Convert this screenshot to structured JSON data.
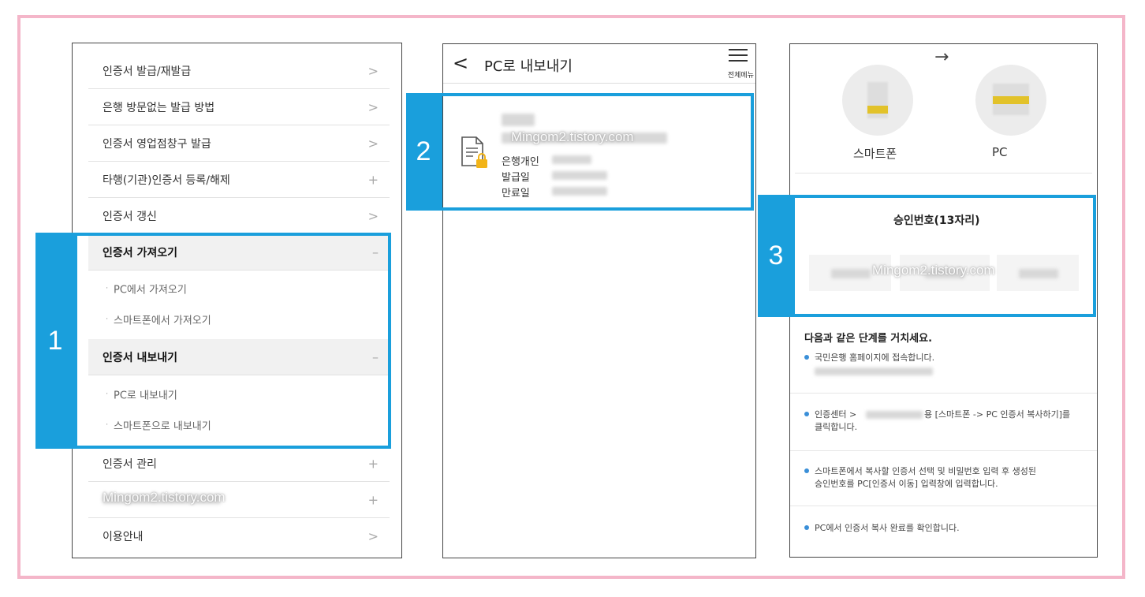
{
  "panel1": {
    "menu": [
      {
        "label": "인증서 발급/재발급",
        "sign": ">"
      },
      {
        "label": "은행 방문없는 발급 방법",
        "sign": ">"
      },
      {
        "label": "인증서 영업점창구 발급",
        "sign": ">"
      },
      {
        "label": "타행(기관)인증서 등록/해제",
        "sign": "+"
      },
      {
        "label": "인증서 갱신",
        "sign": ">"
      },
      {
        "label": "인증서 가져오기",
        "sign": "–"
      },
      {
        "label": "인증서 내보내기",
        "sign": "–"
      },
      {
        "label": "인증서 관리",
        "sign": "+"
      },
      {
        "label": "",
        "sign": "+"
      },
      {
        "label": "이용안내",
        "sign": ">"
      }
    ],
    "import_sub": [
      "PC에서 가져오기",
      "스마트폰에서 가져오기"
    ],
    "export_sub": [
      "PC로 내보내기",
      "스마트폰으로 내보내기"
    ],
    "watermark": "Mingom2.tistory.com",
    "badge": "1"
  },
  "panel2": {
    "back_icon": "<",
    "title": "PC로 내보내기",
    "menu_label": "전체메뉴",
    "cert": {
      "type": "은행개인",
      "issue_label": "발급일",
      "expire_label": "만료일"
    },
    "watermark": "Mingom2.tistory.com",
    "badge": "2"
  },
  "panel3": {
    "from_label": "스마트폰",
    "to_label": "PC",
    "arrow": "→",
    "approval_title": "승인번호(13자리)",
    "watermark": "Mingom2.tistory.com",
    "badge": "3",
    "steps_title": "다음과 같은 단계를 거치세요.",
    "steps": [
      {
        "lines": [
          "국민은행 홈페이지에 접속합니다."
        ]
      },
      {
        "lines": [
          "인증센터 >",
          "용 [스마트폰 -> PC 인증서 복사하기]를",
          "클릭합니다."
        ]
      },
      {
        "lines": [
          "스마트폰에서 복사할 인증서 선택 및 비밀번호 입력 후 생성된",
          "승인번호를 PC[인증서 이동] 입력창에 입력합니다."
        ]
      },
      {
        "lines": [
          "PC에서 인증서 복사 완료를 확인합니다."
        ]
      }
    ]
  },
  "colors": {
    "accent": "#1a9fdc",
    "frame": "#f4b6c9"
  }
}
